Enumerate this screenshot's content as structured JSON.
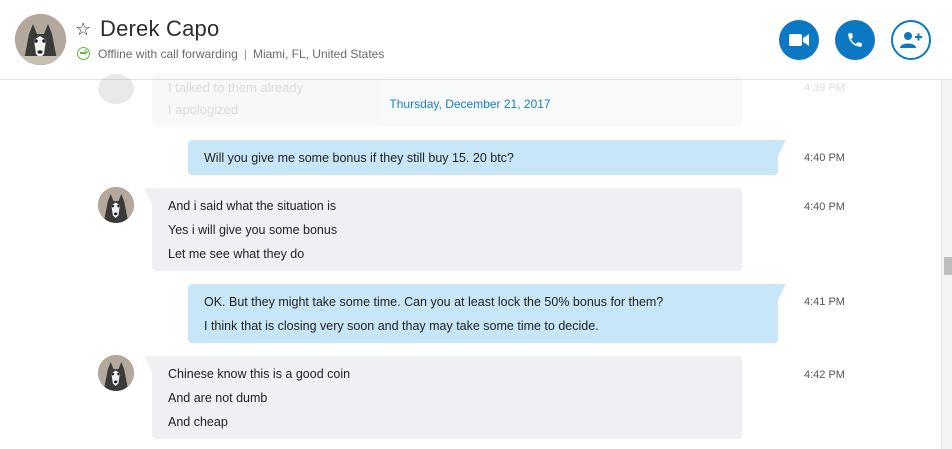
{
  "contact": {
    "name": "Derek Capo",
    "status": "Offline with call forwarding",
    "location": "Miami, FL, United States",
    "separator": "|"
  },
  "icons": {
    "favorite": "star-outline-icon",
    "forwarding": "call-forward-icon",
    "video": "video-call-icon",
    "call": "phone-icon",
    "add_person": "add-person-icon"
  },
  "colors": {
    "accent": "#0a78c2",
    "outgoing_bubble": "#c7e6f8",
    "incoming_bubble": "#eef0f3",
    "date": "#1a7fbf",
    "forward_green": "#6cb33e"
  },
  "previous": {
    "lines": [
      "I talked to them already",
      "I apologized"
    ],
    "time": "4:39 PM"
  },
  "date_separator": "Thursday, December 21, 2017",
  "messages": [
    {
      "direction": "out",
      "lines": [
        "Will you give me some bonus if they still buy 15. 20 btc?"
      ],
      "time": "4:40 PM"
    },
    {
      "direction": "in",
      "lines": [
        "And i said what the situation is",
        "Yes i will give you some bonus",
        "Let me see what they do"
      ],
      "time": "4:40 PM"
    },
    {
      "direction": "out",
      "lines": [
        "OK.  But they might take some time. Can you at least lock the 50% bonus for them?",
        "I think that is closing very soon and thay may take some time to decide."
      ],
      "time": "4:41 PM"
    },
    {
      "direction": "in",
      "lines": [
        "Chinese know this is a good coin",
        "And are not dumb",
        "And cheap"
      ],
      "time": "4:42 PM"
    }
  ]
}
